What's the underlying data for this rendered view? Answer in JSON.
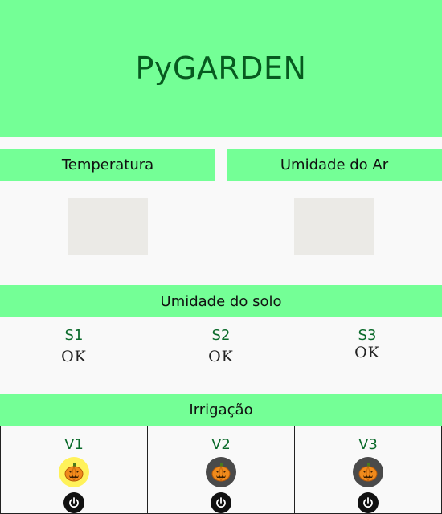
{
  "header": {
    "title": "PyGARDEN"
  },
  "panels": {
    "temperature": {
      "label": "Temperatura",
      "value": ""
    },
    "air_humidity": {
      "label": "Umidade do Ar",
      "value": ""
    }
  },
  "soil": {
    "label": "Umidade do solo",
    "sensors": [
      {
        "name": "S1",
        "status": "OK"
      },
      {
        "name": "S2",
        "status": "OK"
      },
      {
        "name": "S3",
        "status": "OK"
      }
    ]
  },
  "irrigation": {
    "label": "Irrigação",
    "valves": [
      {
        "name": "V1",
        "state": "on",
        "icon": "pumpkin-icon"
      },
      {
        "name": "V2",
        "state": "off",
        "icon": "pumpkin-icon"
      },
      {
        "name": "V3",
        "state": "off",
        "icon": "pumpkin-icon"
      }
    ]
  },
  "colors": {
    "accent_green": "#74ff96",
    "title_green": "#075a1f",
    "valve_on": "#fff25a",
    "valve_off": "#4a4a4a"
  }
}
